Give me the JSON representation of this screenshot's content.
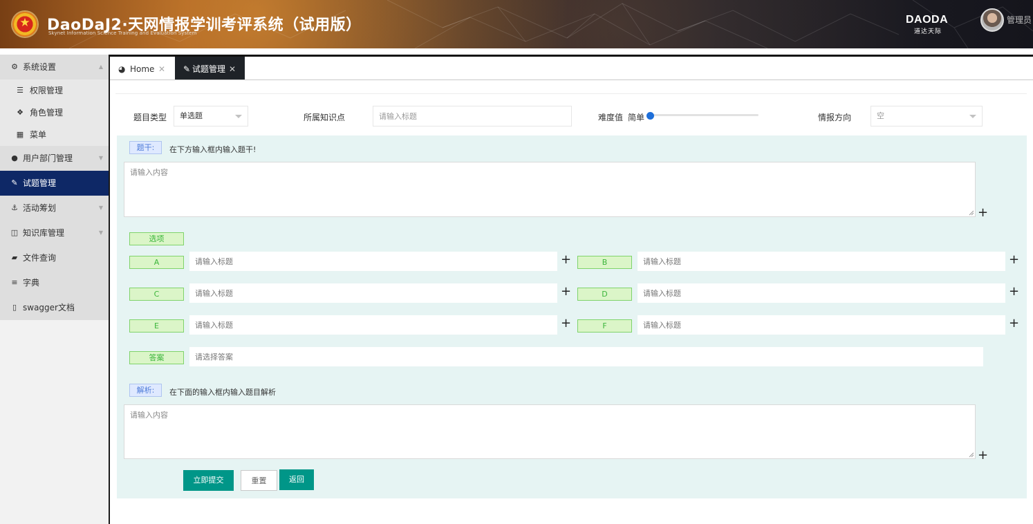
{
  "header": {
    "title": "DaoDaJ2·天网情报学训考评系统（试用版）",
    "subtitle": "Skynet Information Science Training and Evaluation System",
    "brand": "DAODA",
    "brand_sub": "道达天际",
    "user_name": "管理员"
  },
  "sidebar": {
    "items": [
      {
        "label": "系统设置",
        "icon": "gears-icon"
      },
      {
        "label": "权限管理",
        "icon": "list-icon"
      },
      {
        "label": "角色管理",
        "icon": "cubes-icon"
      },
      {
        "label": "菜单",
        "icon": "windows-icon"
      },
      {
        "label": "用户部门管理",
        "icon": "user-icon"
      },
      {
        "label": "试题管理",
        "icon": "edit-icon"
      },
      {
        "label": "活动筹划",
        "icon": "anchor-icon"
      },
      {
        "label": "知识库管理",
        "icon": "columns-icon"
      },
      {
        "label": "文件查询",
        "icon": "folder-open-icon"
      },
      {
        "label": "字典",
        "icon": "bars-icon"
      },
      {
        "label": "swagger文档",
        "icon": "file-pdf-icon"
      }
    ]
  },
  "tabs": {
    "home": "Home",
    "active": "试题管理"
  },
  "filters": {
    "type_label": "题目类型",
    "type_value": "单选题",
    "knowledge_label": "所属知识点",
    "knowledge_placeholder": "请输入标题",
    "difficulty_label": "难度值",
    "difficulty_value": "简单",
    "difficulty_level": 0,
    "direction_label": "情报方向",
    "direction_value": "空"
  },
  "stem": {
    "tag": "题干:",
    "hint": "在下方输入框内输入题干!",
    "placeholder": "请输入内容"
  },
  "options": {
    "tag": "选项",
    "placeholder": "请输入标题",
    "letters": [
      "A",
      "B",
      "C",
      "D",
      "E",
      "F"
    ]
  },
  "answer": {
    "tag": "答案",
    "placeholder": "请选择答案"
  },
  "analysis": {
    "tag": "解析:",
    "hint": "在下面的输入框内输入题目解析",
    "placeholder": "请输入内容"
  },
  "buttons": {
    "submit": "立即提交",
    "reset": "重置",
    "back": "返回"
  },
  "colors": {
    "sidebar_active": "#0e2866",
    "primary_button": "#009688",
    "panel_bg": "#e6f4f3",
    "slider": "#1e6fd9"
  }
}
